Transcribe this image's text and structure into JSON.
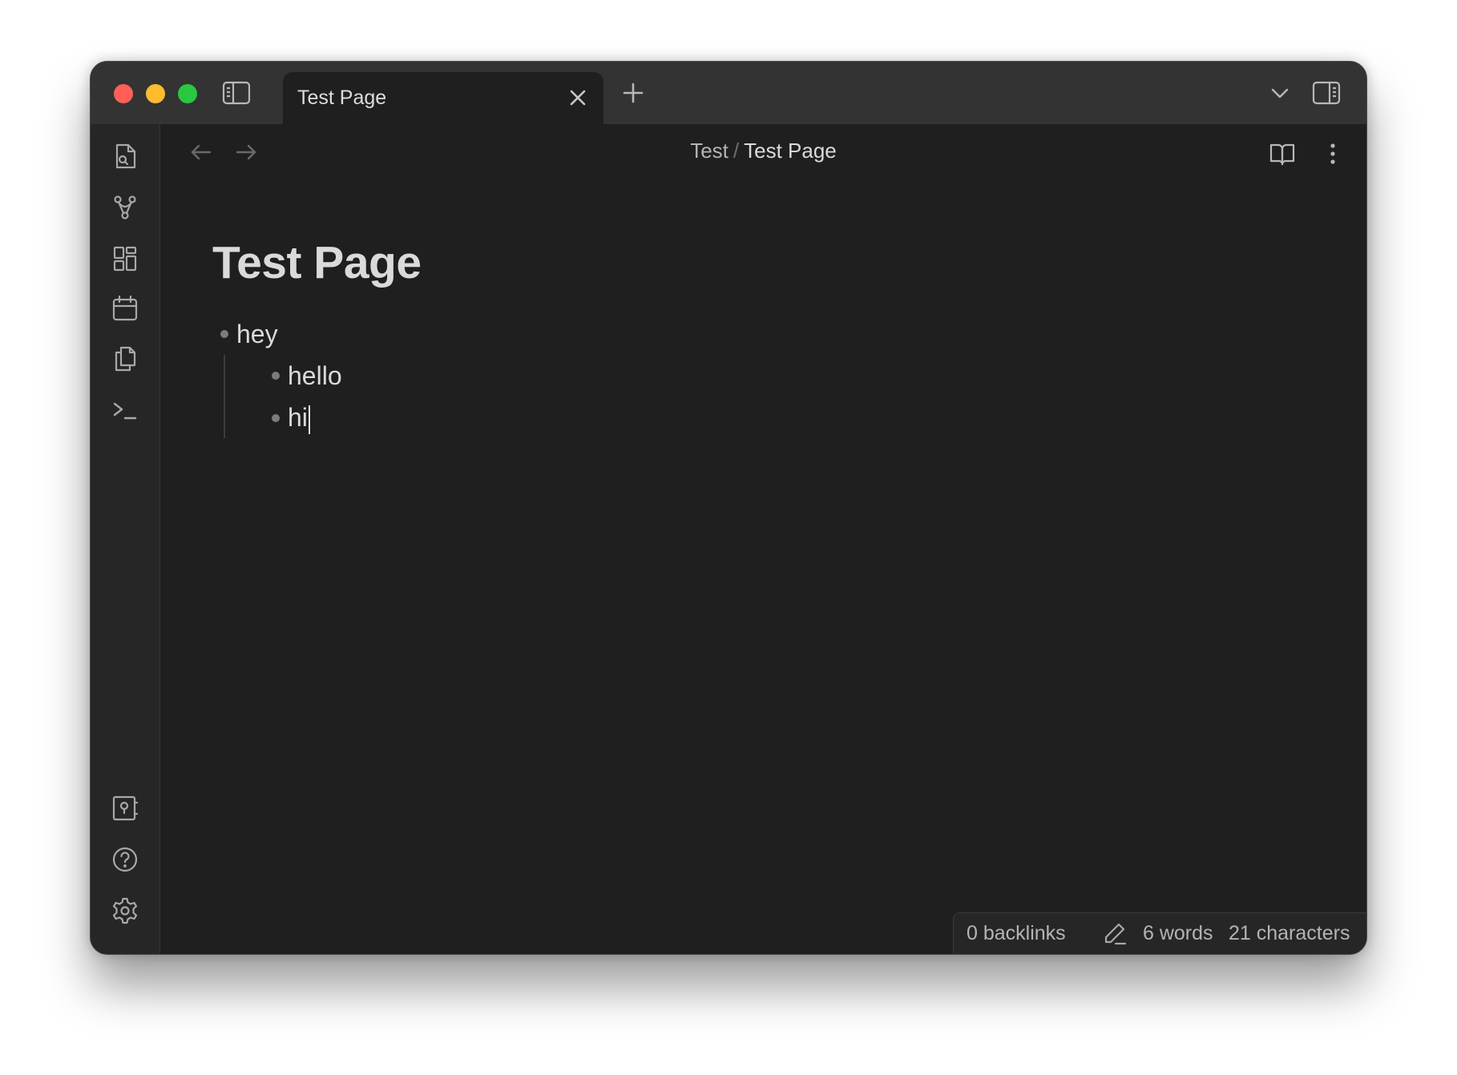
{
  "window": {
    "traffic_lights": [
      "close",
      "minimize",
      "maximize"
    ]
  },
  "titlebar": {
    "left_sidebar_toggle_icon": "sidebar-left-icon",
    "tab": {
      "title": "Test Page",
      "close_icon": "close-icon"
    },
    "new_tab_icon": "plus-icon",
    "tab_list_icon": "chevron-down-icon",
    "right_sidebar_toggle_icon": "sidebar-right-icon"
  },
  "ribbon": {
    "top_icons": [
      "open-quick-switcher-icon",
      "graph-view-icon",
      "canvas-icon",
      "daily-note-icon",
      "templates-icon",
      "command-palette-icon"
    ],
    "bottom_icons": [
      "vault-switcher-icon",
      "help-icon",
      "settings-icon"
    ]
  },
  "header": {
    "breadcrumb": {
      "folder": "Test",
      "separator": "/",
      "current": "Test Page"
    },
    "back_icon": "arrow-left-icon",
    "forward_icon": "arrow-right-icon",
    "reading_view_icon": "book-open-icon",
    "more_options_icon": "more-vertical-icon"
  },
  "note": {
    "title": "Test Page",
    "items": [
      {
        "text": "hey",
        "level": 0
      },
      {
        "text": "hello",
        "level": 1
      },
      {
        "text": "hi",
        "level": 1
      }
    ]
  },
  "statusbar": {
    "backlinks": "0 backlinks",
    "words": "6 words",
    "characters": "21 characters",
    "edit_icon": "pencil-icon"
  },
  "colors": {
    "background": "#1f1f1f",
    "titlebar": "#333333",
    "text": "#dadada",
    "close": "#fe5f57",
    "minimize": "#febc2e",
    "maximize": "#28c840"
  }
}
